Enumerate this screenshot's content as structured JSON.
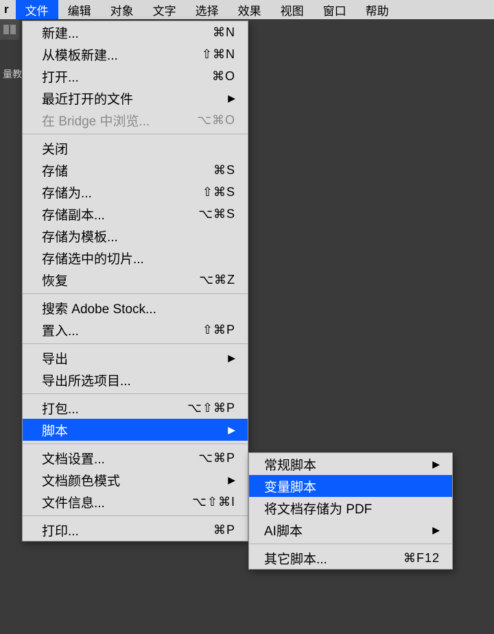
{
  "menubar": {
    "app_initial": "r",
    "items": [
      "文件",
      "编辑",
      "对象",
      "文字",
      "选择",
      "效果",
      "视图",
      "窗口",
      "帮助"
    ],
    "active_index": 0
  },
  "left_label": "量教",
  "file_menu": {
    "groups": [
      [
        {
          "label": "新建...",
          "shortcut": "⌘N"
        },
        {
          "label": "从模板新建...",
          "shortcut": "⇧⌘N"
        },
        {
          "label": "打开...",
          "shortcut": "⌘O"
        },
        {
          "label": "最近打开的文件",
          "arrow": true
        },
        {
          "label": "在 Bridge 中浏览...",
          "shortcut": "⌥⌘O",
          "disabled": true
        }
      ],
      [
        {
          "label": "关闭"
        },
        {
          "label": "存储",
          "shortcut": "⌘S"
        },
        {
          "label": "存储为...",
          "shortcut": "⇧⌘S"
        },
        {
          "label": "存储副本...",
          "shortcut": "⌥⌘S"
        },
        {
          "label": "存储为模板..."
        },
        {
          "label": "存储选中的切片..."
        },
        {
          "label": "恢复",
          "shortcut": "⌥⌘Z"
        }
      ],
      [
        {
          "label": "搜索 Adobe Stock..."
        },
        {
          "label": "置入...",
          "shortcut": "⇧⌘P"
        }
      ],
      [
        {
          "label": "导出",
          "arrow": true
        },
        {
          "label": "导出所选项目..."
        }
      ],
      [
        {
          "label": "打包...",
          "shortcut": "⌥⇧⌘P"
        },
        {
          "label": "脚本",
          "arrow": true,
          "highlight": true
        }
      ],
      [
        {
          "label": "文档设置...",
          "shortcut": "⌥⌘P"
        },
        {
          "label": "文档颜色模式",
          "arrow": true
        },
        {
          "label": "文件信息...",
          "shortcut": "⌥⇧⌘I"
        }
      ],
      [
        {
          "label": "打印...",
          "shortcut": "⌘P"
        }
      ]
    ]
  },
  "scripts_submenu": {
    "groups": [
      [
        {
          "label": "常规脚本",
          "arrow": true
        },
        {
          "label": "变量脚本",
          "highlight": true
        },
        {
          "label": "将文档存储为 PDF"
        },
        {
          "label": "AI脚本",
          "arrow": true
        }
      ],
      [
        {
          "label": "其它脚本...",
          "shortcut": "⌘F12"
        }
      ]
    ]
  }
}
